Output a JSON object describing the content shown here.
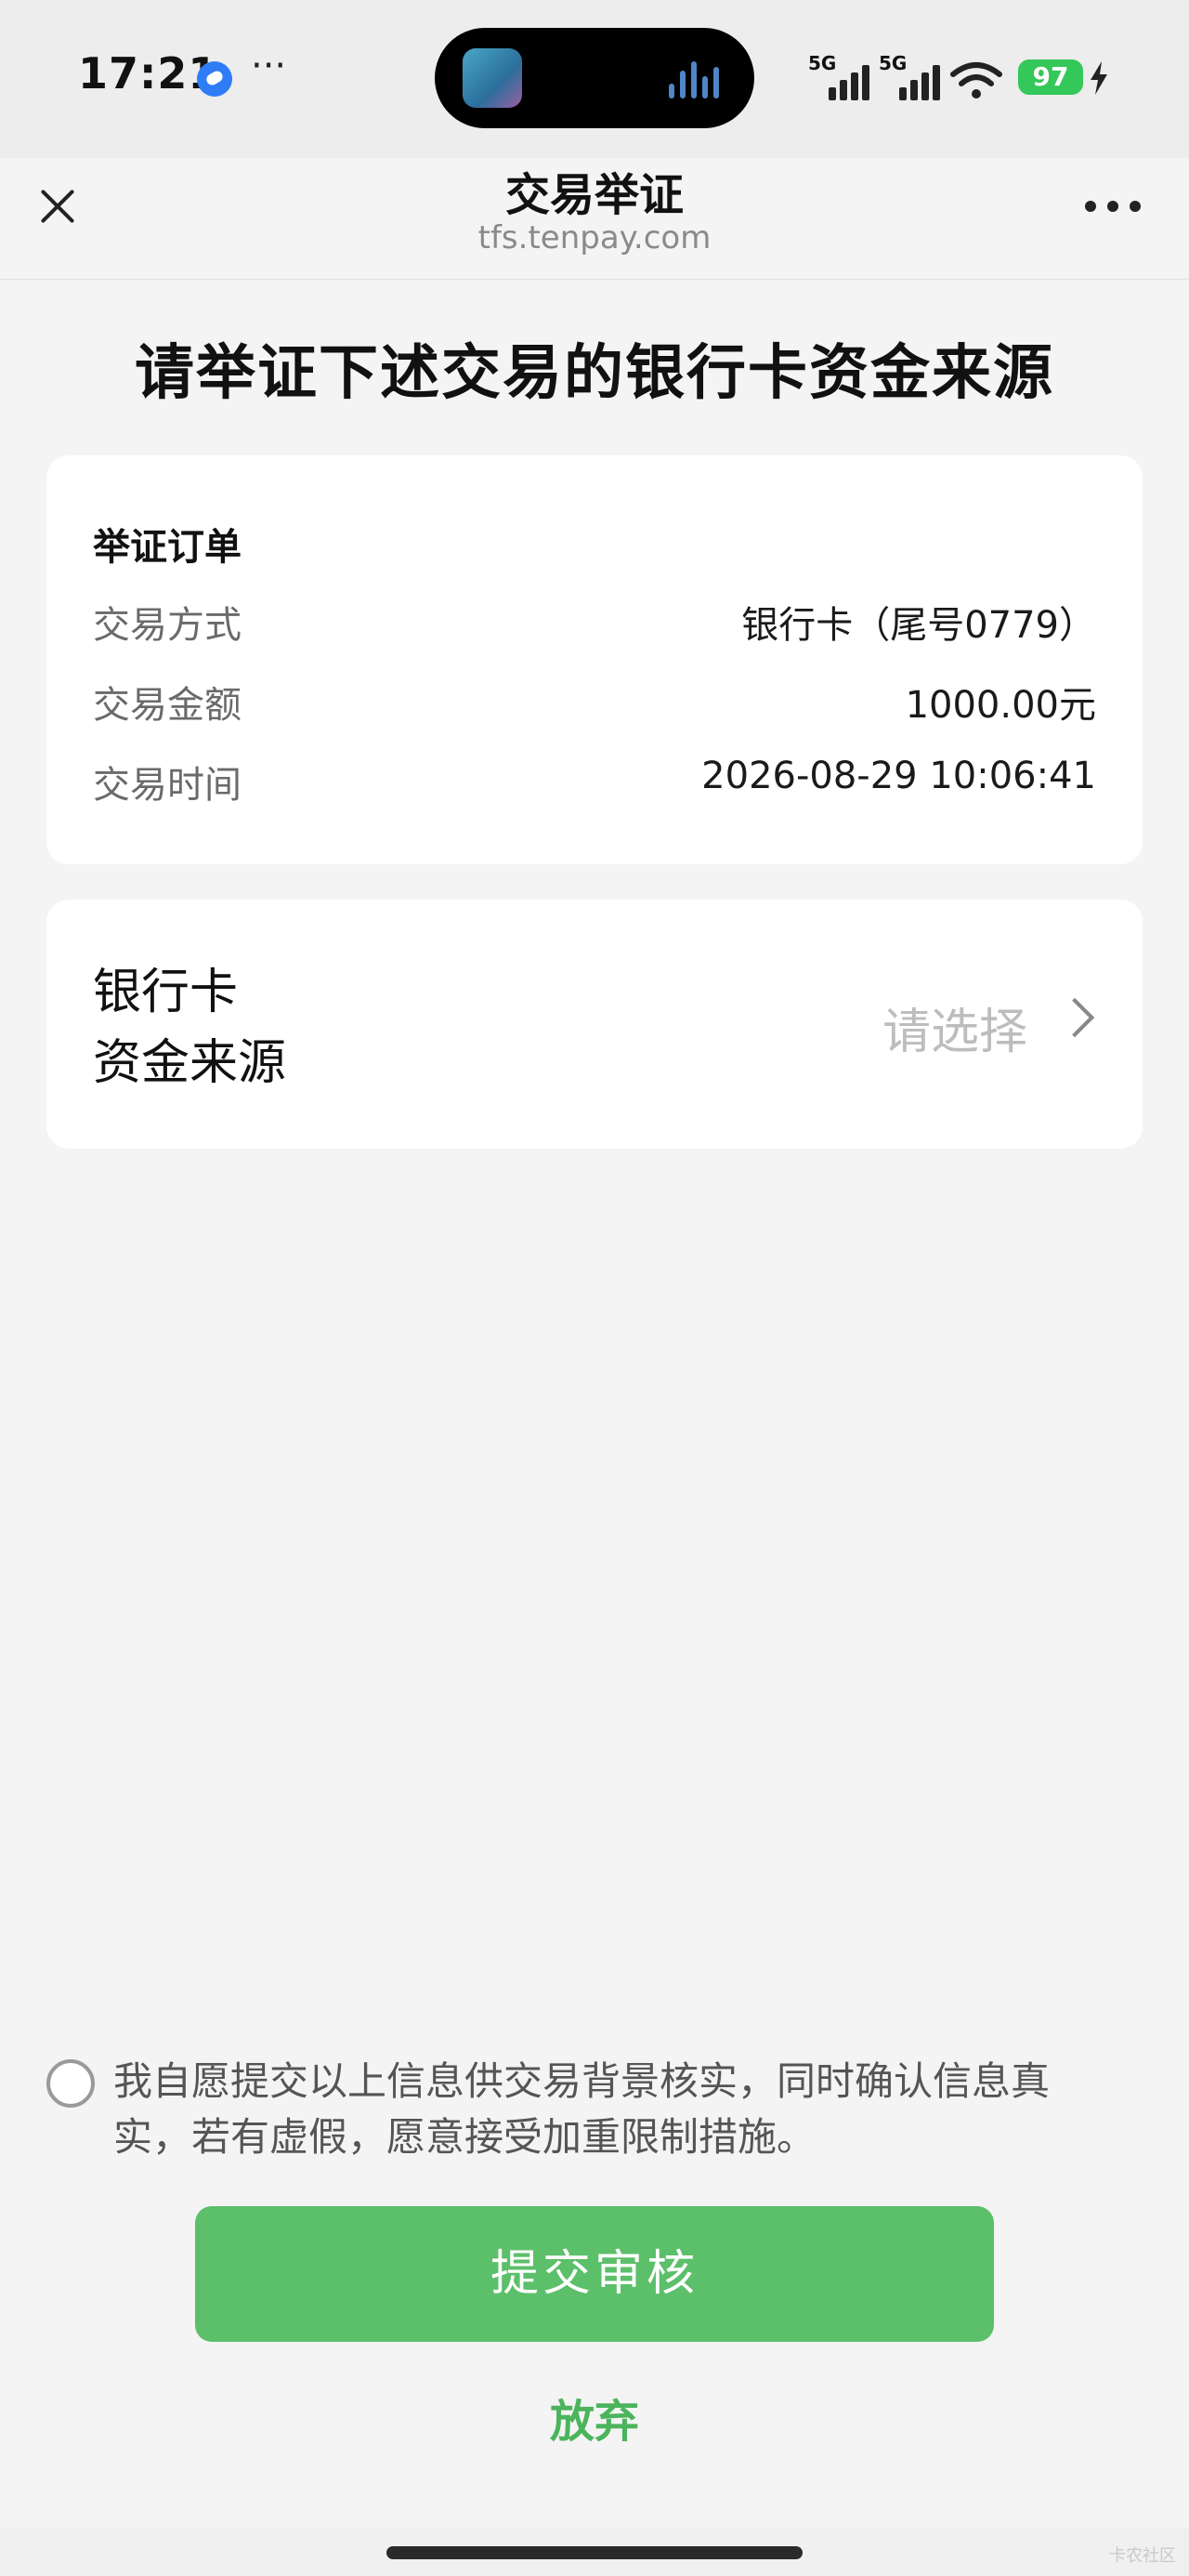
{
  "status_bar": {
    "time": "17:21",
    "more_label": "···",
    "network": [
      "5G",
      "5G"
    ],
    "battery": "97",
    "icons": [
      "app-notification-icon",
      "signal-icon",
      "wifi-icon",
      "battery-icon",
      "charging-icon"
    ]
  },
  "nav": {
    "title": "交易举证",
    "subtitle": "tfs.tenpay.com",
    "close_icon": "close-icon",
    "more_icon": "more-dots-icon"
  },
  "page": {
    "title": "请举证下述交易的银行卡资金来源"
  },
  "order_card": {
    "title": "举证订单",
    "rows": [
      {
        "label": "交易方式",
        "value": "银行卡（尾号0779）"
      },
      {
        "label": "交易金额",
        "value": "1000.00元"
      },
      {
        "label": "交易时间",
        "value": "2026-08-29 10:06:41"
      }
    ]
  },
  "source_card": {
    "label_line1": "银行卡",
    "label_line2": "资金来源",
    "placeholder": "请选择",
    "chevron_icon": "chevron-right-icon"
  },
  "consent": {
    "text": "我自愿提交以上信息供交易背景核实，同时确认信息真实，若有虚假，愿意接受加重限制措施。",
    "checked": false
  },
  "actions": {
    "submit_label": "提交审核",
    "abandon_label": "放弃"
  },
  "watermark": "卡农社区",
  "colors": {
    "accent": "#5cbf6a",
    "accent_text": "#4cb45c",
    "page_bg": "#f4f4f4",
    "card_bg": "#ffffff",
    "placeholder": "#bdbdbd",
    "battery": "#34c759"
  }
}
